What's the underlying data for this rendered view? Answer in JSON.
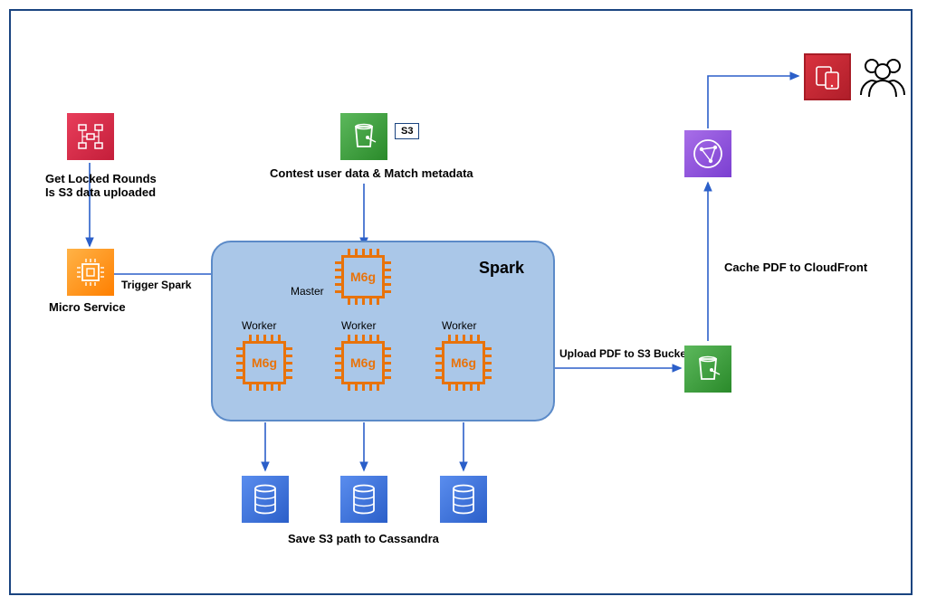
{
  "stepfn": {
    "desc": "Get Locked Rounds\nIs S3 data uploaded"
  },
  "microservice": {
    "label": "Micro Service",
    "trigger_label": "Trigger Spark"
  },
  "s3_top": {
    "tag": "S3",
    "desc": "Contest user data & Match metadata"
  },
  "spark": {
    "title": "Spark",
    "master_label": "Master",
    "worker_label": "Worker",
    "chip_label": "M6g"
  },
  "cassandra": {
    "desc": "Save S3 path to Cassandra"
  },
  "upload_label": "Upload PDF to S3 Bucket",
  "cloudfront": {
    "label": "Cache PDF to CloudFront"
  }
}
